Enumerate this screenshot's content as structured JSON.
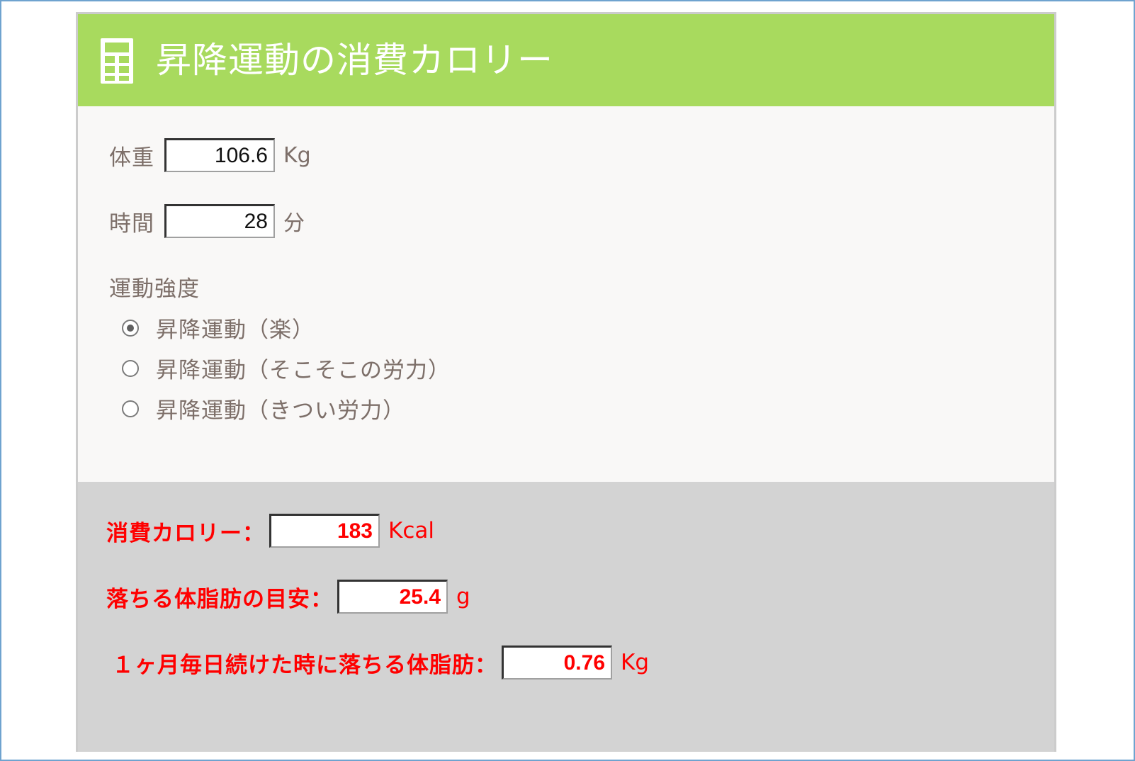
{
  "header": {
    "icon": "calculator-icon",
    "title": "昇降運動の消費カロリー",
    "background_color": "#a8da5e"
  },
  "form": {
    "weight": {
      "label": "体重",
      "value": "106.6",
      "unit": "Kg"
    },
    "time": {
      "label": "時間",
      "value": "28",
      "unit": "分"
    },
    "intensity": {
      "label": "運動強度",
      "options": [
        {
          "label": "昇降運動（楽）",
          "checked": true
        },
        {
          "label": "昇降運動（そこそこの労力）",
          "checked": false
        },
        {
          "label": "昇降運動（きつい労力）",
          "checked": false
        }
      ]
    }
  },
  "results": {
    "calories": {
      "label": "消費カロリー：",
      "value": "183",
      "unit": "Kcal"
    },
    "fat": {
      "label": "落ちる体脂肪の目安：",
      "value": "25.4",
      "unit": "g"
    },
    "monthly_fat": {
      "label": "１ヶ月毎日続けた時に落ちる体脂肪：",
      "value": "0.76",
      "unit": "Kg"
    },
    "accent_color": "#ff0000"
  }
}
